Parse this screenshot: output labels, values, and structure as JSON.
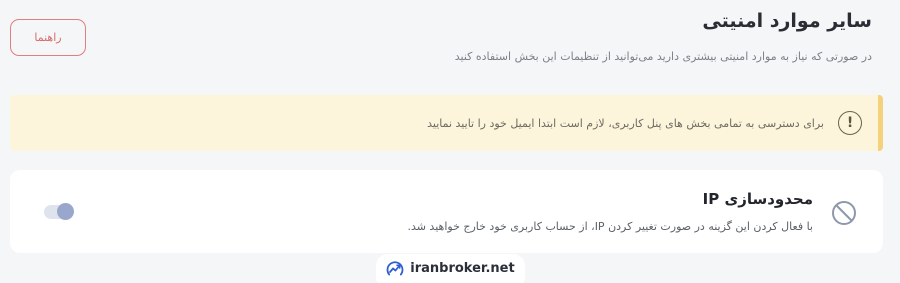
{
  "header": {
    "title": "سایر موارد امنیتی",
    "subtitle": "در صورتی که نیاز به موارد امنیتی بیشتری دارید می‌توانید از تنظیمات این بخش استفاده کنید",
    "help_label": "راهنما"
  },
  "alert": {
    "icon": "exclamation-icon",
    "text": "برای دسترسی به تمامی بخش های پنل کاربری، لازم است ابتدا ایمیل خود را تایید نمایید",
    "colors": {
      "background": "#fdf4dc",
      "border": "#f4d27c"
    }
  },
  "ip_restriction": {
    "icon": "block-icon",
    "title": "محدودسازی IP",
    "description": "با فعال کردن این گزینه در صورت تغییر کردن IP، از حساب کاربری خود خارج خواهید شد.",
    "toggle_enabled": false
  },
  "watermark": {
    "icon": "chart-logo-icon",
    "text": "iranbroker.net"
  },
  "colors": {
    "accent": "#d96a6a",
    "toggle_track": "#dfe3ee",
    "toggle_knob": "#9aa7cc"
  }
}
